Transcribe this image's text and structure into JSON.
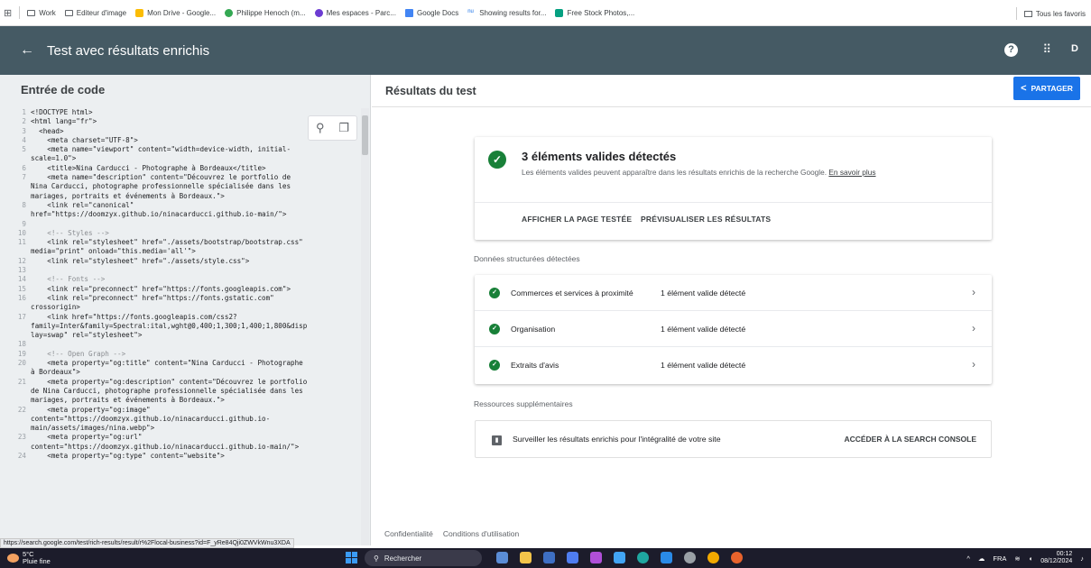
{
  "bookmarks": {
    "items": [
      "Work",
      "Editeur d'image",
      "Mon Drive - Google...",
      "Philippe Henoch (m...",
      "Mes espaces - Parc...",
      "Google Docs",
      "Showing results for...",
      "Free Stock Photos,..."
    ],
    "all_label": "Tous les favoris"
  },
  "appbar": {
    "title": "Test avec résultats enrichis",
    "help": "?",
    "avatar": "D"
  },
  "left": {
    "title": "Entrée de code",
    "code": [
      {
        "n": "1",
        "t": "<!DOCTYPE html>"
      },
      {
        "n": "2",
        "t": "<html lang=\"fr\">"
      },
      {
        "n": "3",
        "t": "  <head>"
      },
      {
        "n": "4",
        "t": "    <meta charset=\"UTF-8\">"
      },
      {
        "n": "5",
        "t": "    <meta name=\"viewport\" content=\"width=device-width, initial-"
      },
      {
        "n": "",
        "t": "scale=1.0\">"
      },
      {
        "n": "6",
        "t": "    <title>Nina Carducci - Photographe à Bordeaux</title>"
      },
      {
        "n": "7",
        "t": "    <meta name=\"description\" content=\"Découvrez le portfolio de"
      },
      {
        "n": "",
        "t": "Nina Carducci, photographe professionnelle spécialisée dans les"
      },
      {
        "n": "",
        "t": "mariages, portraits et événements à Bordeaux.\">"
      },
      {
        "n": "8",
        "t": "    <link rel=\"canonical\""
      },
      {
        "n": "",
        "t": "href=\"https://doomzyx.github.io/ninacarducci.github.io-main/\">"
      },
      {
        "n": "9",
        "t": ""
      },
      {
        "n": "10",
        "t": "    <!-- Styles -->"
      },
      {
        "n": "11",
        "t": "    <link rel=\"stylesheet\" href=\"./assets/bootstrap/bootstrap.css\""
      },
      {
        "n": "",
        "t": "media=\"print\" onload=\"this.media='all'\">"
      },
      {
        "n": "12",
        "t": "    <link rel=\"stylesheet\" href=\"./assets/style.css\">"
      },
      {
        "n": "13",
        "t": ""
      },
      {
        "n": "14",
        "t": "    <!-- Fonts -->"
      },
      {
        "n": "15",
        "t": "    <link rel=\"preconnect\" href=\"https://fonts.googleapis.com\">"
      },
      {
        "n": "16",
        "t": "    <link rel=\"preconnect\" href=\"https://fonts.gstatic.com\""
      },
      {
        "n": "",
        "t": "crossorigin>"
      },
      {
        "n": "17",
        "t": "    <link href=\"https://fonts.googleapis.com/css2?"
      },
      {
        "n": "",
        "t": "family=Inter&family=Spectral:ital,wght@0,400;1,300;1,400;1,800&disp"
      },
      {
        "n": "",
        "t": "lay=swap\" rel=\"stylesheet\">"
      },
      {
        "n": "18",
        "t": ""
      },
      {
        "n": "19",
        "t": "    <!-- Open Graph -->"
      },
      {
        "n": "20",
        "t": "    <meta property=\"og:title\" content=\"Nina Carducci - Photographe"
      },
      {
        "n": "",
        "t": "à Bordeaux\">"
      },
      {
        "n": "21",
        "t": "    <meta property=\"og:description\" content=\"Découvrez le portfolio"
      },
      {
        "n": "",
        "t": "de Nina Carducci, photographe professionnelle spécialisée dans les"
      },
      {
        "n": "",
        "t": "mariages, portraits et événements à Bordeaux.\">"
      },
      {
        "n": "22",
        "t": "    <meta property=\"og:image\""
      },
      {
        "n": "",
        "t": "content=\"https://doomzyx.github.io/ninacarducci.github.io-"
      },
      {
        "n": "",
        "t": "main/assets/images/nina.webp\">"
      },
      {
        "n": "23",
        "t": "    <meta property=\"og:url\""
      },
      {
        "n": "",
        "t": "content=\"https://doomzyx.github.io/ninacarducci.github.io-main/\">"
      },
      {
        "n": "24",
        "t": "    <meta property=\"og:type\" content=\"website\">"
      }
    ]
  },
  "right": {
    "title": "Résultats du test",
    "share_label": "PARTAGER",
    "summary": {
      "title": "3 éléments valides détectés",
      "desc": "Les éléments valides peuvent apparaître dans les résultats enrichis de la recherche Google.",
      "link": "En savoir plus",
      "btn_tested": "AFFICHER LA PAGE TESTÉE",
      "btn_preview": "PRÉVISUALISER LES RÉSULTATS"
    },
    "structured_label": "Données structurées détectées",
    "items": [
      {
        "name": "Commerces et services à proximité",
        "status": "1 élément valide détecté"
      },
      {
        "name": "Organisation",
        "status": "1 élément valide détecté"
      },
      {
        "name": "Extraits d'avis",
        "status": "1 élément valide détecté"
      }
    ],
    "resources_label": "Ressources supplémentaires",
    "resource": {
      "text": "Surveiller les résultats enrichis pour l'intégralité de votre site",
      "action": "ACCÉDER À LA SEARCH CONSOLE"
    },
    "footer": [
      "Confidentialité",
      "Conditions d'utilisation"
    ]
  },
  "status_url": "https://search.google.com/test/rich-results/result/r%2Flocal-business?id=F_yRe84Qji0ZWVkWnu3XDA",
  "taskbar": {
    "temp": "5°C",
    "weather": "Pluie fine",
    "search": "Rechercher",
    "lang": "FRA",
    "time": "00:12",
    "date": "08/12/2024"
  }
}
